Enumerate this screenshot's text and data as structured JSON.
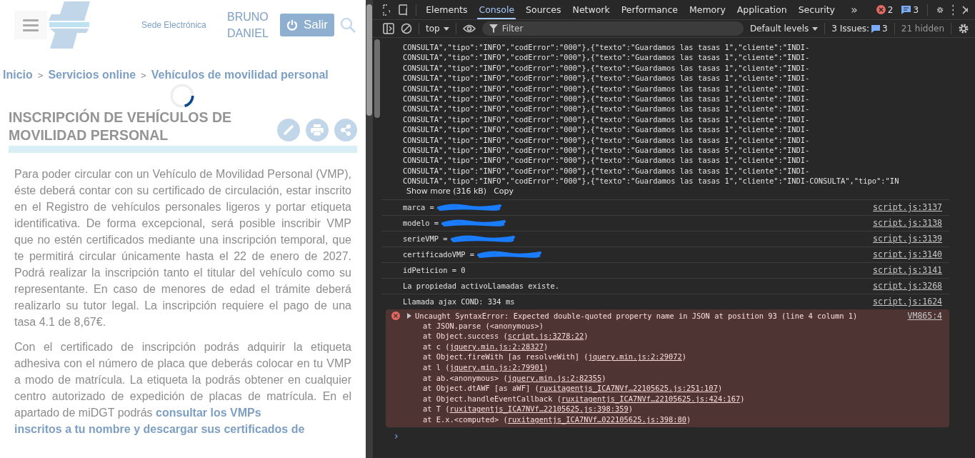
{
  "page": {
    "site_label": "Sede Electrónica",
    "user_name": "BRUNO DANIEL",
    "logout_button": "Salir",
    "breadcrumb": [
      {
        "label": "Inicio"
      },
      {
        "label": "Servicios online"
      },
      {
        "label": "Vehículos de movilidad personal"
      }
    ],
    "breadcrumb_separator": ">",
    "title": "INSCRIPCIÓN DE VEHÍCULOS DE MOVILIDAD PERSONAL",
    "paragraphs": [
      {
        "text": "Para poder circular con un Vehículo de Movilidad Personal (VMP), éste deberá contar con su certificado de circulación, estar inscrito en el Registro de vehículos personales ligeros y portar etiqueta identificativa. De forma excepcional, será posible inscribir VMP que no estén certificados mediante una inscripción temporal, que te permitirá circular únicamente hasta el 22 de enero de 2027. Podrá realizar la inscripción tanto el titular del vehículo como su representante. En caso de menores de edad el trámite deberá realizarlo su tutor legal. La inscripción requiere el pago de una tasa 4.1 de 8,67€."
      },
      {
        "text": "Con el certificado de inscripción podrás adquirir la etiqueta adhesiva con el número de placa que deberás colocar en tu VMP a modo de matrícula. La etiqueta la podrás obtener en cualquier centro autorizado de expedición de placas de matrícula. En el apartado de miDGT podrás",
        "link": [
          "consultar los VMPs",
          "inscritos a tu nombre y descargar sus certificados de"
        ]
      }
    ],
    "loading": true
  },
  "devtools": {
    "tabs": [
      {
        "label": "Elements",
        "selected": false
      },
      {
        "label": "Console",
        "selected": true
      },
      {
        "label": "Sources",
        "selected": false
      },
      {
        "label": "Network",
        "selected": false
      },
      {
        "label": "Performance",
        "selected": false
      },
      {
        "label": "Memory",
        "selected": false
      },
      {
        "label": "Application",
        "selected": false
      },
      {
        "label": "Security",
        "selected": false
      }
    ],
    "more_tabs": "»",
    "error_count": "2",
    "message_count": "3",
    "context": "top",
    "filter_placeholder": "Filter",
    "levels": "Default levels",
    "issues_label": "3 Issues:",
    "issues_count": "3",
    "hidden": "21 hidden",
    "json_lines": [
      "CONSULTA\",\"tipo\":\"INFO\",\"codError\":\"000\"},{\"texto\":\"Guardamos las tasas 1\",\"cliente\":\"INDI-",
      "CONSULTA\",\"tipo\":\"INFO\",\"codError\":\"000\"},{\"texto\":\"Guardamos las tasas 1\",\"cliente\":\"INDI-",
      "CONSULTA\",\"tipo\":\"INFO\",\"codError\":\"000\"},{\"texto\":\"Guardamos las tasas 1\",\"cliente\":\"INDI-",
      "CONSULTA\",\"tipo\":\"INFO\",\"codError\":\"000\"},{\"texto\":\"Guardamos las tasas 1\",\"cliente\":\"INDI-",
      "CONSULTA\",\"tipo\":\"INFO\",\"codError\":\"000\"},{\"texto\":\"Guardamos las tasas 1\",\"cliente\":\"INDI-",
      "CONSULTA\",\"tipo\":\"INFO\",\"codError\":\"000\"},{\"texto\":\"Guardamos las tasas 1\",\"cliente\":\"INDI-",
      "CONSULTA\",\"tipo\":\"INFO\",\"codError\":\"000\"},{\"texto\":\"Guardamos las tasas 1\",\"cliente\":\"INDI-",
      "CONSULTA\",\"tipo\":\"INFO\",\"codError\":\"000\"},{\"texto\":\"Guardamos las tasas 1\",\"cliente\":\"INDI-",
      "CONSULTA\",\"tipo\":\"INFO\",\"codError\":\"000\"},{\"texto\":\"Guardamos las tasas 1\",\"cliente\":\"INDI-",
      "CONSULTA\",\"tipo\":\"INFO\",\"codError\":\"000\"},{\"texto\":\"Guardamos las tasas 1\",\"cliente\":\"INDI-",
      "CONSULTA\",\"tipo\":\"INFO\",\"codError\":\"000\"},{\"texto\":\"Guardamos las tasas 5\",\"cliente\":\"INDI-",
      "CONSULTA\",\"tipo\":\"INFO\",\"codError\":\"000\"},{\"texto\":\"Guardamos las tasas 1\",\"cliente\":\"INDI-",
      "CONSULTA\",\"tipo\":\"INFO\",\"codError\":\"000\"},{\"texto\":\"Guardamos las tasas 1\",\"cliente\":\"INDI-",
      "CONSULTA\",\"tipo\":\"INFO\",\"codError\":\"000\"},{\"texto\":\"Guardamos las tasas 1\",\"cliente\":\"INDI-CONSULTA\",\"tipo\":\"IN"
    ],
    "show_more": "Show more (316 kB)",
    "copy": "Copy",
    "logs": [
      {
        "text": "marca =",
        "redacted": true,
        "source": "script.js:3137"
      },
      {
        "text": "modelo =",
        "redacted": true,
        "source": "script.js:3138"
      },
      {
        "text": "serieVMP =",
        "redacted": true,
        "source": "script.js:3139"
      },
      {
        "text": "certificadoVMP =",
        "redacted": true,
        "source": "script.js:3140"
      },
      {
        "text": "idPeticion = 0",
        "redacted": false,
        "source": "script.js:3141"
      },
      {
        "text": "La propiedad activoLlamadas existe.",
        "redacted": false,
        "source": "script.js:3268"
      },
      {
        "text": "Llamada ajax COND: 334 ms",
        "redacted": false,
        "source": "script.js:1624"
      }
    ],
    "error": {
      "message": "Uncaught SyntaxError: Expected double-quoted property name in JSON at position 93 (line 4 column 1)",
      "source": "VM865:4",
      "expanded": false,
      "stack": [
        {
          "before": "at JSON.parse (<anonymous>)"
        },
        {
          "before": "at Object.success (",
          "link": "script.js:3278:22",
          "after": ")"
        },
        {
          "before": "at c (",
          "link": "jquery.min.js:2:28327",
          "after": ")"
        },
        {
          "before": "at Object.fireWith [as resolveWith] (",
          "link": "jquery.min.js:2:29072",
          "after": ")"
        },
        {
          "before": "at l (",
          "link": "jquery.min.js:2:79901",
          "after": ")"
        },
        {
          "before": "at ab.<anonymous> (",
          "link": "jquery.min.js:2:82355",
          "after": ")"
        },
        {
          "before": "at Object.dtAWF [as aWF] (",
          "link": "ruxitagentjs_ICA7NVf…22105625.js:251:107",
          "after": ")"
        },
        {
          "before": "at Object.handleEventCallback (",
          "link": "ruxitagentjs_ICA7NVf…22105625.js:424:167",
          "after": ")"
        },
        {
          "before": "at T (",
          "link": "ruxitagentjs_ICA7NVf…22105625.js:398:359",
          "after": ")"
        },
        {
          "before": "at E.x.<computed> (",
          "link": "ruxitagentjs_ICA7NVf…022105625.js:398:80",
          "after": ")"
        }
      ]
    },
    "prompt": "›"
  }
}
